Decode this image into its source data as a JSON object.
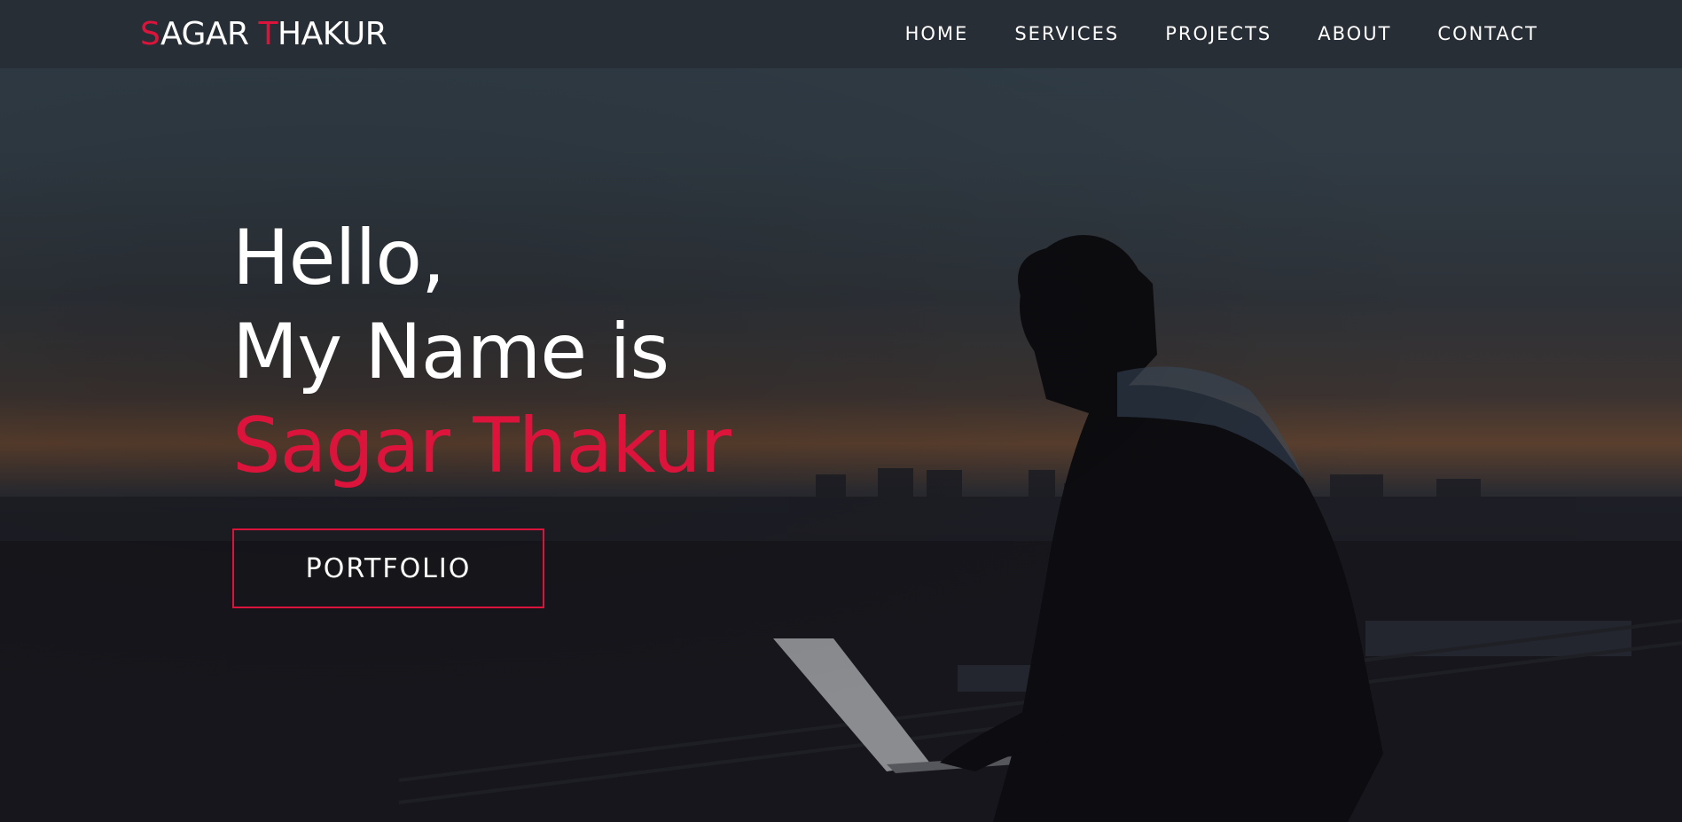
{
  "brand": {
    "first_initial": "S",
    "first_rest": "AGAR ",
    "last_initial": "T",
    "last_rest": "HAKUR",
    "accent_color": "#dc143c"
  },
  "nav": {
    "items": [
      {
        "label": "HOME"
      },
      {
        "label": "SERVICES"
      },
      {
        "label": "PROJECTS"
      },
      {
        "label": "ABOUT"
      },
      {
        "label": "CONTACT"
      }
    ]
  },
  "hero": {
    "line1": "Hello,",
    "line2": "My Name is",
    "name": "Sagar Thakur",
    "button_label": "PORTFOLIO",
    "background_image": "silhouette-of-person-with-laptop-over-city-at-dusk"
  }
}
